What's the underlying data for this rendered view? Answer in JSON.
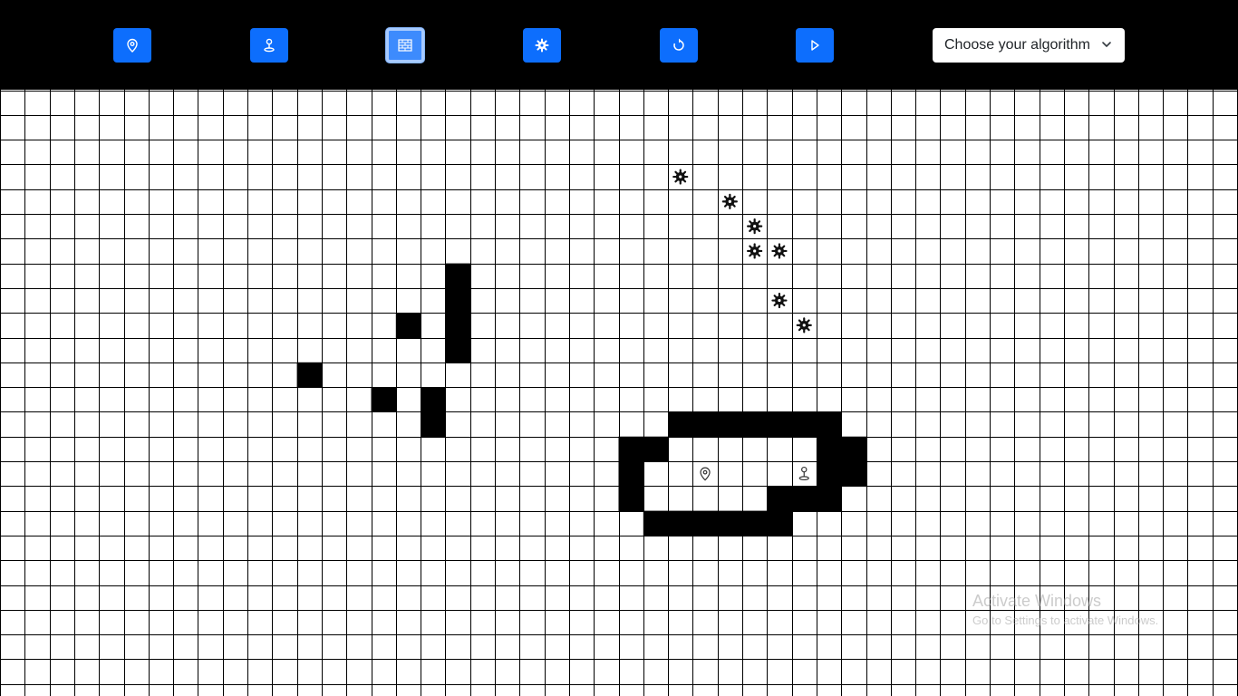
{
  "toolbar": {
    "buttons": [
      {
        "icon": "map-pin-icon",
        "active": false
      },
      {
        "icon": "joystick-icon",
        "active": false
      },
      {
        "icon": "brick-wall-icon",
        "active": true
      },
      {
        "icon": "gear-icon",
        "active": false
      },
      {
        "icon": "reset-icon",
        "active": false
      },
      {
        "icon": "play-icon",
        "active": false
      }
    ],
    "algorithm_select": {
      "label": "Choose your algorithm"
    }
  },
  "grid": {
    "columns": 50,
    "rows": 25,
    "walls": [
      [
        18,
        7
      ],
      [
        18,
        8
      ],
      [
        18,
        9
      ],
      [
        18,
        10
      ],
      [
        16,
        9
      ],
      [
        12,
        11
      ],
      [
        15,
        12
      ],
      [
        17,
        12
      ],
      [
        17,
        13
      ],
      [
        27,
        13
      ],
      [
        28,
        13
      ],
      [
        29,
        13
      ],
      [
        30,
        13
      ],
      [
        31,
        13
      ],
      [
        32,
        13
      ],
      [
        33,
        13
      ],
      [
        25,
        14
      ],
      [
        26,
        14
      ],
      [
        33,
        14
      ],
      [
        34,
        14
      ],
      [
        25,
        15
      ],
      [
        33,
        15
      ],
      [
        34,
        15
      ],
      [
        25,
        16
      ],
      [
        31,
        16
      ],
      [
        32,
        16
      ],
      [
        33,
        16
      ],
      [
        26,
        17
      ],
      [
        27,
        17
      ],
      [
        28,
        17
      ],
      [
        29,
        17
      ],
      [
        30,
        17
      ],
      [
        31,
        17
      ]
    ],
    "weights": [
      [
        27,
        3
      ],
      [
        29,
        4
      ],
      [
        30,
        5
      ],
      [
        30,
        6
      ],
      [
        31,
        6
      ],
      [
        31,
        8
      ],
      [
        32,
        9
      ]
    ],
    "start": [
      28,
      15
    ],
    "target": [
      32,
      15
    ],
    "colors": {
      "wall": "#000000",
      "line": "#000000",
      "weight": "#111111"
    }
  },
  "watermark": {
    "title": "Activate Windows",
    "subtitle": "Go to Settings to activate Windows."
  }
}
